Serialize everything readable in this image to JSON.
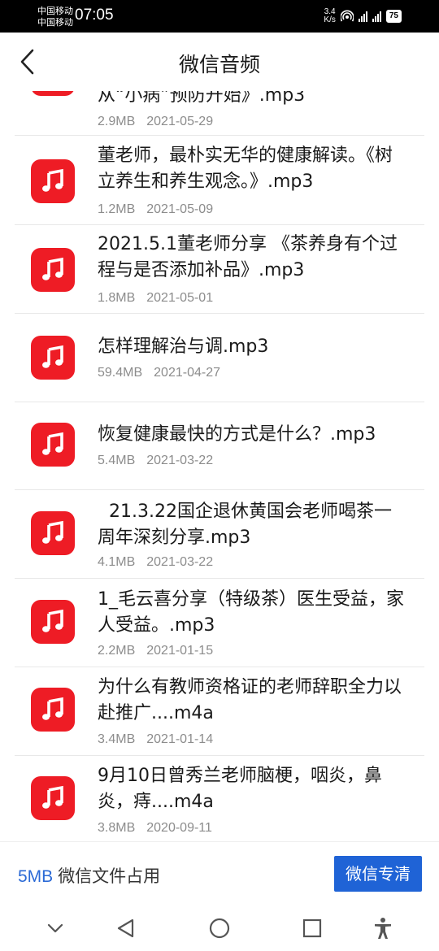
{
  "status_bar": {
    "carrier_1": "中国移动",
    "carrier_2": "中国移动",
    "time": "07:05",
    "net_speed_value": "3.4",
    "net_speed_unit": "K/s",
    "battery": "75"
  },
  "header": {
    "title": "微信音频"
  },
  "files": [
    {
      "name": "从“小病”预防开始》.mp3",
      "size": "2.9MB",
      "date": "2021-05-29"
    },
    {
      "name": "董老师，最朴实无华的健康解读。《树立养生和养生观念。》.mp3",
      "size": "1.2MB",
      "date": "2021-05-09"
    },
    {
      "name": "2021.5.1董老师分享 《茶养身有个过程与是否添加补品》.mp3",
      "size": "1.8MB",
      "date": "2021-05-01"
    },
    {
      "name": "怎样理解治与调.mp3",
      "size": "59.4MB",
      "date": "2021-04-27"
    },
    {
      "name": "恢复健康最快的方式是什么？.mp3",
      "size": "5.4MB",
      "date": "2021-03-22"
    },
    {
      "name": "  21.3.22国企退休黄国会老师喝茶一周年深刻分享.mp3",
      "size": "4.1MB",
      "date": "2021-03-22"
    },
    {
      "name": "1_毛云喜分享（特级茶）医生受益，家人受益。.mp3",
      "size": "2.2MB",
      "date": "2021-01-15"
    },
    {
      "name": "为什么有教师资格证的老师辞职全力以赴推广....m4a",
      "size": "3.4MB",
      "date": "2021-01-14"
    },
    {
      "name": "9月10日曾秀兰老师脑梗，咽炎，鼻炎，痔....m4a",
      "size": "3.8MB",
      "date": "2020-09-11"
    }
  ],
  "footer": {
    "storage_size": "5MB",
    "storage_label": "微信文件占用",
    "clean_button": "微信专清"
  },
  "colors": {
    "icon_red": "#ee1c25",
    "accent_blue": "#1f63d6"
  }
}
